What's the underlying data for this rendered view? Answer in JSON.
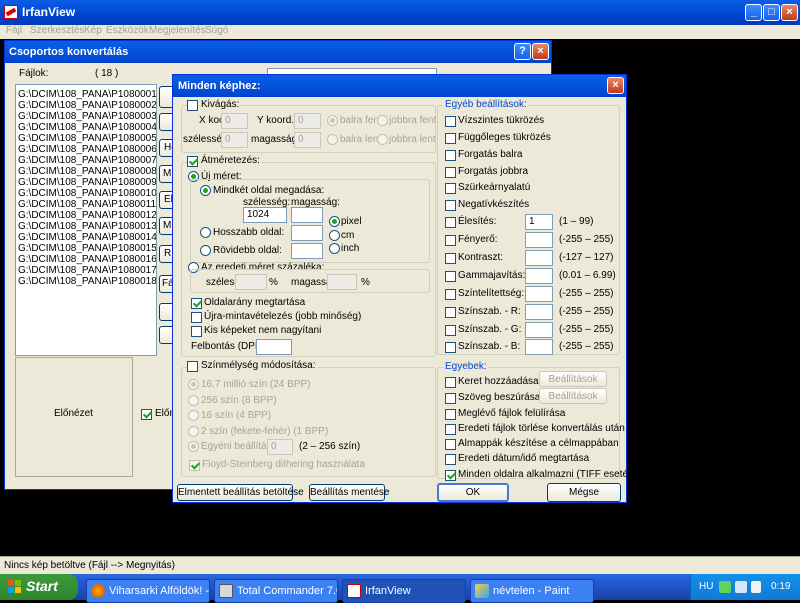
{
  "app": {
    "title": "IrfanView",
    "menu": [
      "Fájl",
      "Szerkesztés",
      "Kép",
      "Eszközök",
      "Megjelenítés",
      "Súgó"
    ],
    "status": "Nincs kép betöltve (Fájl --> Megnyitás)"
  },
  "batch": {
    "title": "Csoportos konvertálás",
    "files_label": "Fájlok:",
    "files_count": "( 18 )",
    "files": [
      "G:\\DCIM\\108_PANA\\P1080001.JP",
      "G:\\DCIM\\108_PANA\\P1080002.JP",
      "G:\\DCIM\\108_PANA\\P1080003.JP",
      "G:\\DCIM\\108_PANA\\P1080004.JP",
      "G:\\DCIM\\108_PANA\\P1080005.JP",
      "G:\\DCIM\\108_PANA\\P1080006.JP",
      "G:\\DCIM\\108_PANA\\P1080007.JP",
      "G:\\DCIM\\108_PANA\\P1080008.JP",
      "G:\\DCIM\\108_PANA\\P1080009.JP",
      "G:\\DCIM\\108_PANA\\P1080010.JP",
      "G:\\DCIM\\108_PANA\\P1080011.JP",
      "G:\\DCIM\\108_PANA\\P1080012.JP",
      "G:\\DCIM\\108_PANA\\P1080013.JP",
      "G:\\DCIM\\108_PANA\\P1080014.JP",
      "G:\\DCIM\\108_PANA\\P1080015.JP",
      "G:\\DCIM\\108_PANA\\P1080016.JP",
      "G:\\DCIM\\108_PANA\\P1080017.JP",
      "G:\\DCIM\\108_PANA\\P1080018.JP"
    ],
    "side_buttons": [
      "Ho",
      "Min",
      "Eli",
      "Min",
      "R"
    ],
    "side_button_fajl": "Fájl",
    "preview_label": "Előnézet",
    "preview_checkbox": "Előn"
  },
  "dialog": {
    "title": "Minden képhez:",
    "crop": {
      "label": "Kivágás:",
      "x_label": "X koord.:",
      "x_value": "0",
      "y_label": "Y koord.:",
      "y_value": "0",
      "width_label": "szélesség:",
      "width_value": "0",
      "height_label": "magasság:",
      "height_value": "0",
      "top_left": "balra fent",
      "top_right": "jobbra fent",
      "bottom_left": "balra lent",
      "bottom_right": "jobbra lent"
    },
    "resize": {
      "label": "Átméretezés:",
      "new_size": "Új méret:",
      "both_sides": "Mindkét oldal megadása:",
      "width_label": "szélesség:",
      "height_label": "magasság:",
      "width_value": "1024",
      "height_value": "",
      "longer_side": "Hosszabb oldal:",
      "shorter_side": "Rövidebb oldal:",
      "unit_pixel": "pixel",
      "unit_cm": "cm",
      "unit_inch": "inch",
      "percent": "Az eredeti méret százaléka:",
      "pct_width_label": "szélesség:",
      "pct_height_label": "magasság:",
      "pct_symbol": "%",
      "keep_aspect": "Oldalarány megtartása",
      "resample": "Újra-mintavételezés (jobb minőség)",
      "no_enlarge": "Kis képeket nem nagyítani",
      "dpi_label": "Felbontás (DPI):",
      "dpi_value": ""
    },
    "color_depth": {
      "label": "Színmélység módosítása:",
      "options": [
        "16,7 millió szín (24 BPP)",
        "256 szín (8 BPP)",
        "16 szín (4 BPP)",
        "2 szín (fekete-fehér) (1 BPP)"
      ],
      "custom": "Egyéni beállítás:",
      "custom_value": "0",
      "custom_range": "(2 – 256 szín)",
      "dither": "Floyd-Steinberg dithering használata"
    },
    "other_settings": {
      "title": "Egyéb beállítások:",
      "flip_h": "Vízszintes tükrözés",
      "flip_v": "Függőleges tükrözés",
      "rotate_left": "Forgatás balra",
      "rotate_right": "Forgatás jobbra",
      "grayscale": "Szürkeárnyalatú",
      "negative": "Negatívkészítés",
      "sharpen": {
        "label": "Élesítés:",
        "value": "1",
        "range": "(1 – 99)"
      },
      "brightness": {
        "label": "Fényerő:",
        "value": "",
        "range": "(-255 – 255)"
      },
      "contrast": {
        "label": "Kontraszt:",
        "value": "",
        "range": "(-127 – 127)"
      },
      "gamma": {
        "label": "Gammajavítás:",
        "value": "",
        "range": "(0.01 – 6.99)"
      },
      "saturation": {
        "label": "Színtelítettség:",
        "value": "",
        "range": "(-255 – 255)"
      },
      "bal_r": {
        "label": "Színszab. - R:",
        "value": "",
        "range": "(-255 – 255)"
      },
      "bal_g": {
        "label": "Színszab. - G:",
        "value": "",
        "range": "(-255 – 255)"
      },
      "bal_b": {
        "label": "Színszab. - B:",
        "value": "",
        "range": "(-255 – 255)"
      }
    },
    "misc": {
      "title": "Egyebek:",
      "add_border": "Keret hozzáadása",
      "insert_text": "Szöveg beszúrása",
      "settings_btn": "Beállítások",
      "overwrite": "Meglévő fájlok felülírása",
      "delete_originals": "Eredeti fájlok törlése konvertálás után",
      "create_subfolders": "Almappák készítése a célmappában",
      "keep_date": "Eredeti dátum/idő megtartása",
      "apply_all_pages": "Minden oldalra alkalmazni (TIFF esetén)"
    },
    "buttons": {
      "load": "Elmentett beállítás betöltése",
      "save": "Beállítás mentése",
      "ok": "OK",
      "cancel": "Mégse"
    }
  },
  "taskbar": {
    "start": "Start",
    "items": [
      "Viharsarki Alföldök! - Fi...",
      "Total Commander 7.0...",
      "IrfanView",
      "névtelen - Paint"
    ],
    "lang": "HU",
    "clock": "0:19"
  }
}
